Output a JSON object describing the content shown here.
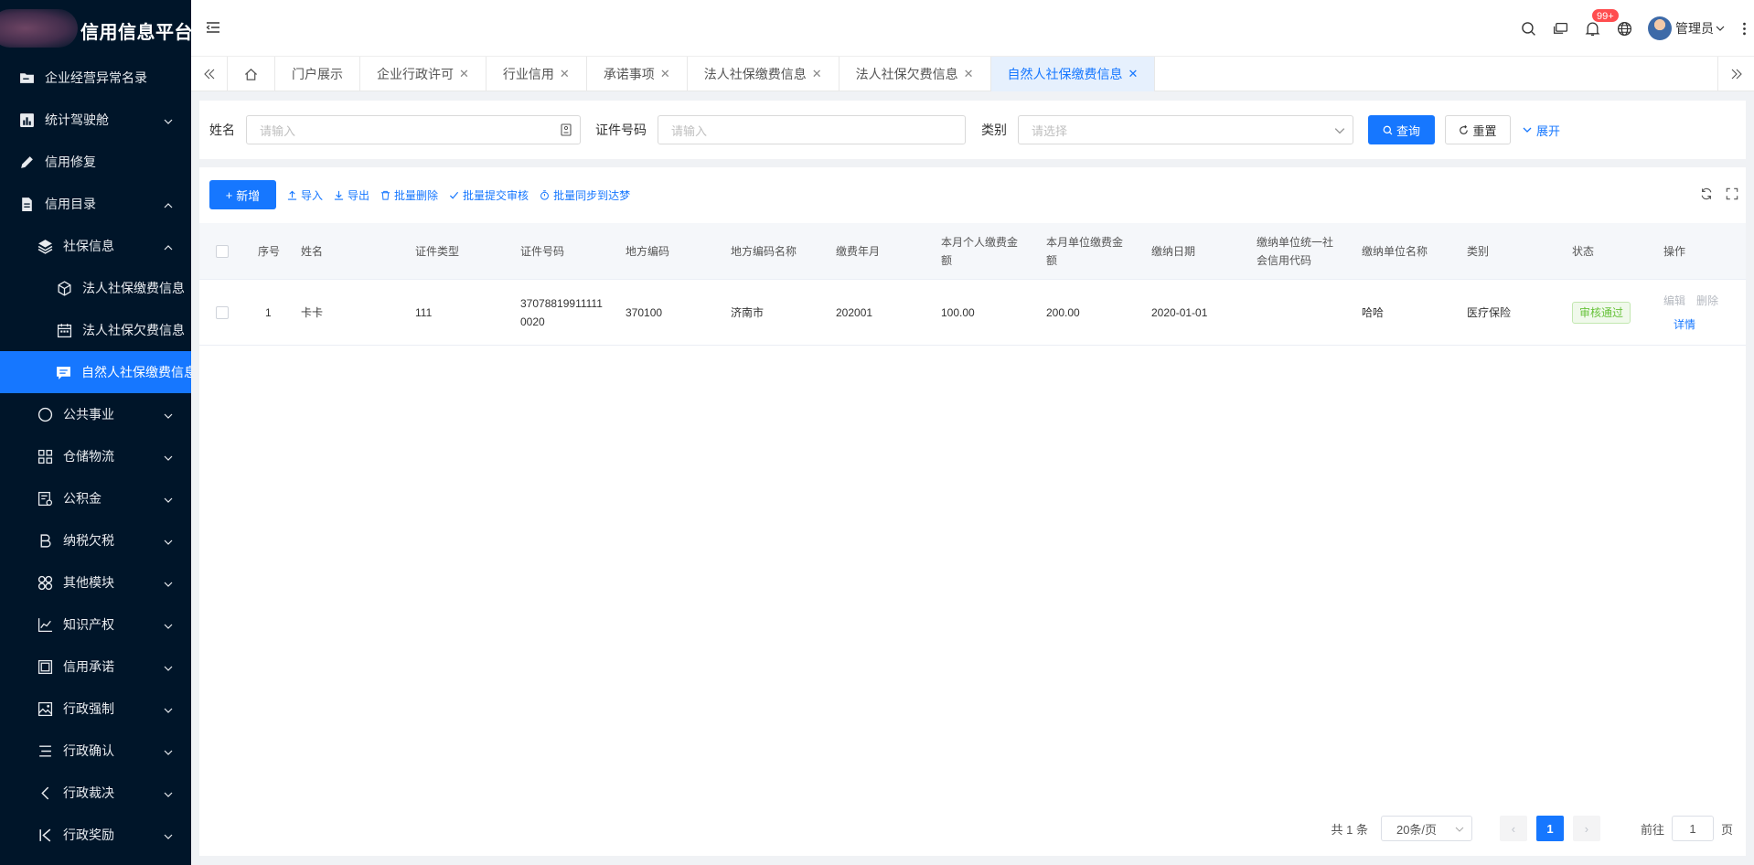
{
  "app": {
    "title": "信用信息平台"
  },
  "sidebar": {
    "items": [
      {
        "label": "企业经营异常名录",
        "icon": "folder-icon"
      },
      {
        "label": "统计驾驶舱",
        "icon": "bar-chart-icon"
      },
      {
        "label": "信用修复",
        "icon": "pen-icon"
      },
      {
        "label": "信用目录",
        "icon": "document-icon"
      },
      {
        "label": "社保信息",
        "icon": "layers-icon"
      },
      {
        "label": "法人社保缴费信息",
        "icon": "cube-icon"
      },
      {
        "label": "法人社保欠费信息",
        "icon": "calendar-icon"
      },
      {
        "label": "自然人社保缴费信息",
        "icon": "message-icon"
      },
      {
        "label": "公共事业",
        "icon": "circle-icon"
      },
      {
        "label": "仓储物流",
        "icon": "grid-icon"
      },
      {
        "label": "公积金",
        "icon": "audit-icon"
      },
      {
        "label": "纳税欠税",
        "icon": "bold-icon"
      },
      {
        "label": "其他模块",
        "icon": "apps-icon"
      },
      {
        "label": "知识产权",
        "icon": "line-chart-icon"
      },
      {
        "label": "信用承诺",
        "icon": "frame-icon"
      },
      {
        "label": "行政强制",
        "icon": "picture-icon"
      },
      {
        "label": "行政确认",
        "icon": "align-icon"
      },
      {
        "label": "行政裁决",
        "icon": "left-arrow-icon"
      },
      {
        "label": "行政奖励",
        "icon": "step-backward-icon"
      }
    ]
  },
  "header": {
    "notification_count": "99+",
    "user_name": "管理员"
  },
  "tabs": [
    {
      "label": "门户展示"
    },
    {
      "label": "企业行政许可"
    },
    {
      "label": "行业信用"
    },
    {
      "label": "承诺事项"
    },
    {
      "label": "法人社保缴费信息"
    },
    {
      "label": "法人社保欠费信息"
    },
    {
      "label": "自然人社保缴费信息"
    }
  ],
  "search": {
    "name_label": "姓名",
    "name_placeholder": "请输入",
    "id_label": "证件号码",
    "id_placeholder": "请输入",
    "type_label": "类别",
    "type_placeholder": "请选择",
    "query_btn": "查询",
    "reset_btn": "重置",
    "expand_btn": "展开"
  },
  "toolbar": {
    "add": "新增",
    "import": "导入",
    "export": "导出",
    "batch_delete": "批量删除",
    "batch_submit": "批量提交审核",
    "batch_sync": "批量同步到达梦"
  },
  "table": {
    "headers": {
      "index": "序号",
      "name": "姓名",
      "id_type": "证件类型",
      "id_no": "证件号码",
      "region_code": "地方编码",
      "region_name": "地方编码名称",
      "pay_month": "缴费年月",
      "personal_amount_1": "本月个人缴费金",
      "personal_amount_2": "额",
      "unit_amount_1": "本月单位缴费金",
      "unit_amount_2": "额",
      "pay_date": "缴纳日期",
      "credit_code_1": "缴纳单位统一社",
      "credit_code_2": "会信用代码",
      "unit_name": "缴纳单位名称",
      "category": "类别",
      "status": "状态",
      "ops": "操作"
    },
    "rows": [
      {
        "index": "1",
        "name": "卡卡",
        "id_type": "111",
        "id_no_1": "37078819911111",
        "id_no_2": "0020",
        "region_code": "370100",
        "region_name": "济南市",
        "pay_month": "202001",
        "personal_amount": "100.00",
        "unit_amount": "200.00",
        "pay_date": "2020-01-01",
        "credit_code": "",
        "unit_name": "哈哈",
        "category": "医疗保险",
        "status": "审核通过",
        "edit": "编辑",
        "delete": "删除",
        "detail": "详情"
      }
    ]
  },
  "pagination": {
    "total": "共 1 条",
    "page_size": "20条/页",
    "current": "1",
    "goto_label": "前往",
    "goto_value": "1",
    "page_suffix": "页"
  },
  "colors": {
    "primary": "#1677ff",
    "sidebar": "#001529",
    "success": "#67c23a",
    "badge": "#ff4d4f"
  }
}
